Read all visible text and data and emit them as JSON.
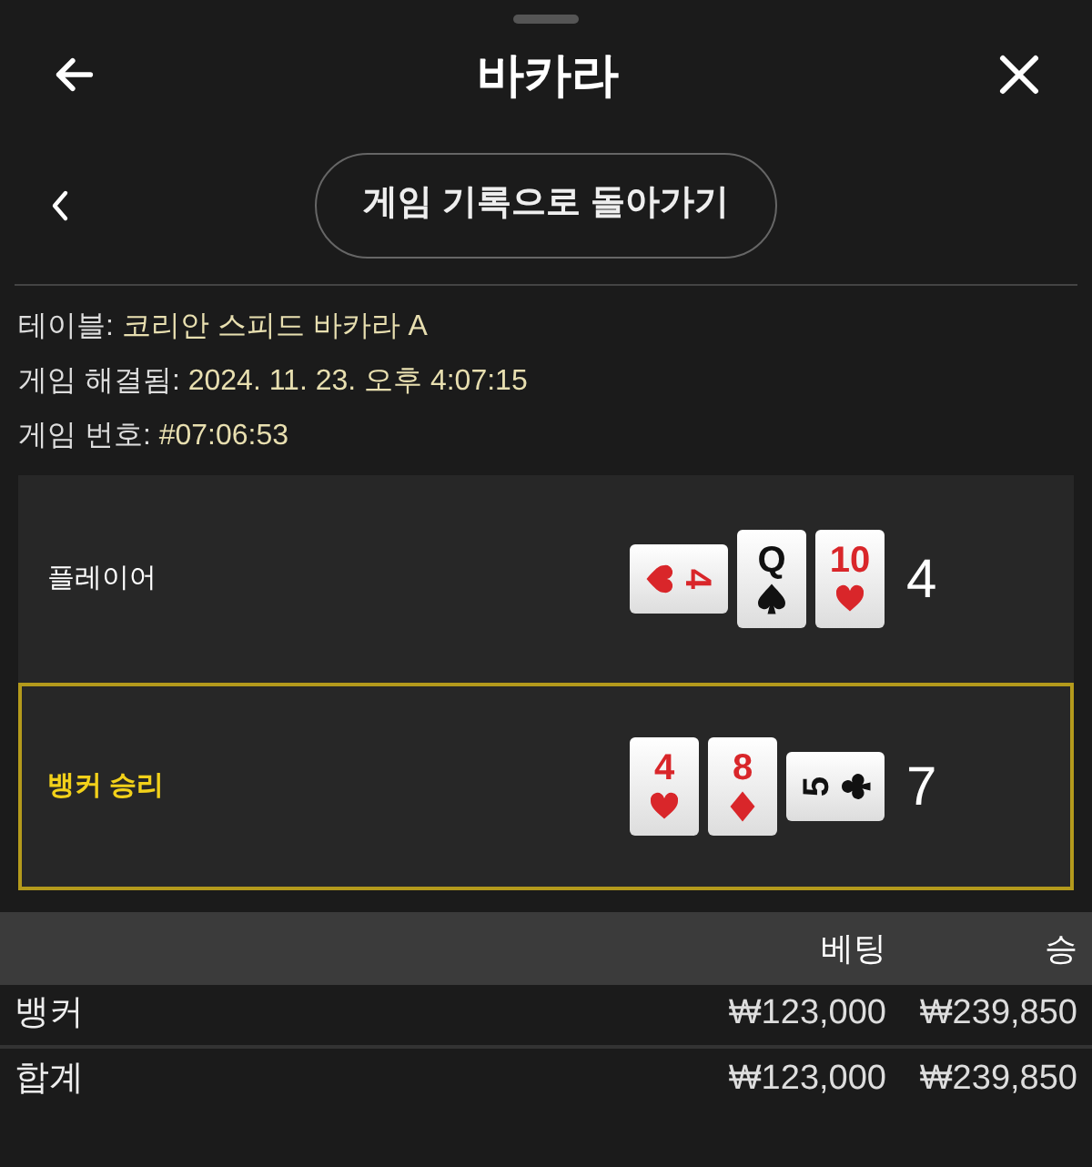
{
  "header": {
    "title": "바카라"
  },
  "back_button": {
    "label": "게임 기록으로 돌아가기"
  },
  "info": [
    {
      "label": "테이블:",
      "value": "코리안 스피드 바카라 A"
    },
    {
      "label": "게임 해결됨:",
      "value": "2024. 11. 23. 오후 4:07:15"
    },
    {
      "label": "게임 번호:",
      "value": "#07:06:53"
    }
  ],
  "hands": [
    {
      "label": "플레이어",
      "winner": false,
      "total": "4",
      "cards": [
        {
          "rank": "4",
          "kind": "heart",
          "sideways": true,
          "reversed": false
        },
        {
          "rank": "Q",
          "kind": "spade",
          "sideways": false,
          "reversed": false
        },
        {
          "rank": "10",
          "kind": "heart",
          "sideways": false,
          "reversed": false
        }
      ]
    },
    {
      "label": "뱅커 승리",
      "winner": true,
      "total": "7",
      "cards": [
        {
          "rank": "4",
          "kind": "heart",
          "sideways": false,
          "reversed": false
        },
        {
          "rank": "8",
          "kind": "diamond",
          "sideways": false,
          "reversed": false
        },
        {
          "rank": "5",
          "kind": "club",
          "sideways": true,
          "reversed": true
        }
      ]
    }
  ],
  "bets_table": {
    "columns": [
      "베팅",
      "승"
    ],
    "rows": [
      {
        "label": "뱅커",
        "bet": "₩123,000",
        "win": "₩239,850"
      },
      {
        "label": "합계",
        "bet": "₩123,000",
        "win": "₩239,850"
      }
    ]
  }
}
